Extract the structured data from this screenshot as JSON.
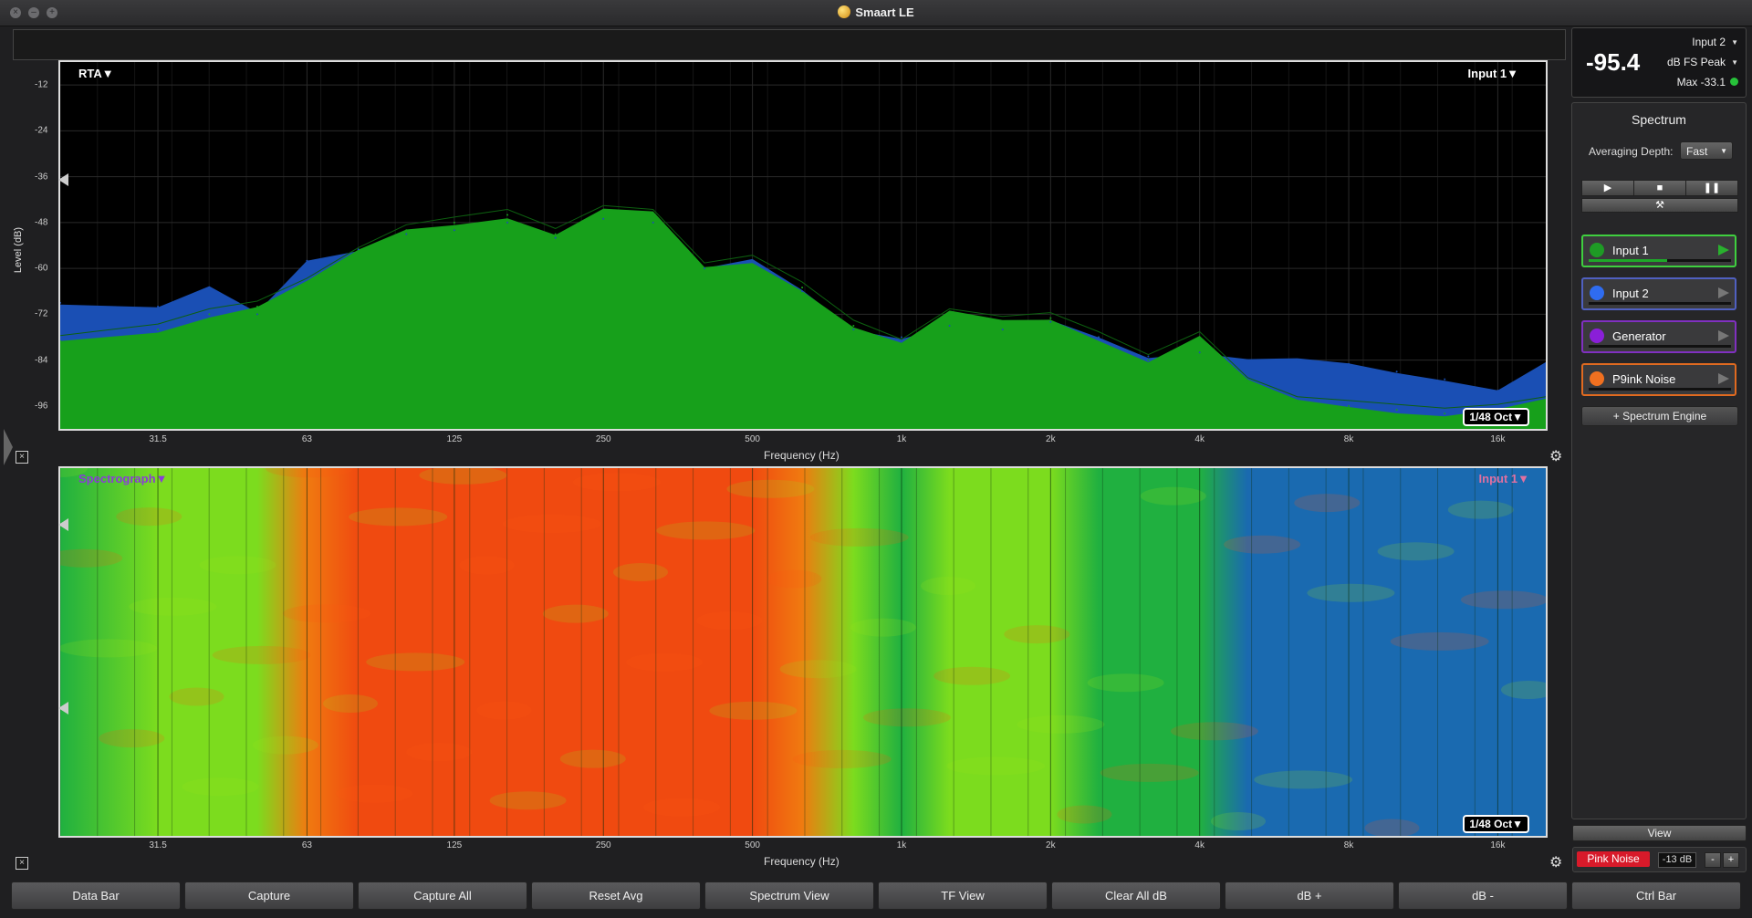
{
  "window": {
    "title": "Smaart LE"
  },
  "meter": {
    "value": "-95.4",
    "input": "Input 2",
    "mode": "dB FS Peak",
    "max": "Max -33.1"
  },
  "rta": {
    "mode_label": "RTA▼",
    "input_label": "Input 1▼",
    "resolution": "1/48 Oct▼",
    "ylabel": "Level (dB)",
    "xlabel": "Frequency (Hz)",
    "yticks": [
      "-12",
      "-24",
      "-36",
      "-48",
      "-60",
      "-72",
      "-84",
      "-96"
    ],
    "xticks": [
      "31.5",
      "63",
      "125",
      "250",
      "500",
      "1k",
      "2k",
      "4k",
      "8k",
      "16k"
    ]
  },
  "spectrograph": {
    "mode_label": "Spectrograph▼",
    "input_label": "Input 1▼",
    "resolution": "1/48 Oct▼",
    "xlabel": "Frequency (Hz)",
    "xticks": [
      "31.5",
      "63",
      "125",
      "250",
      "500",
      "1k",
      "2k",
      "4k",
      "8k",
      "16k"
    ]
  },
  "chart_data": {
    "type": "area",
    "title": "RTA",
    "xlabel": "Frequency (Hz)",
    "ylabel": "Level (dB)",
    "x_scale": "log",
    "xlim": [
      20,
      20000
    ],
    "ylim": [
      -102,
      -6
    ],
    "grid": true,
    "x": [
      20,
      31.5,
      40,
      50,
      63,
      80,
      100,
      125,
      160,
      200,
      250,
      315,
      400,
      500,
      630,
      800,
      1000,
      1250,
      1600,
      2000,
      2500,
      3150,
      4000,
      5000,
      6300,
      8000,
      10000,
      12500,
      16000,
      20000
    ],
    "series": [
      {
        "name": "Input 1",
        "color": "#17a01b",
        "values": [
          -79,
          -76,
          -72,
          -70,
          -64,
          -56,
          -50,
          -48,
          -46,
          -51,
          -45,
          -46,
          -60,
          -58,
          -65,
          -75,
          -80,
          -72,
          -74,
          -73,
          -78,
          -84,
          -78,
          -90,
          -95,
          -96,
          -97,
          -98,
          -97,
          -95
        ]
      },
      {
        "name": "Input 2",
        "color": "#1a4fb4",
        "values": [
          -69,
          -70,
          -65,
          -72,
          -58,
          -55,
          -51,
          -50,
          -48,
          -52,
          -47,
          -48,
          -60,
          -58,
          -66,
          -76,
          -78,
          -75,
          -76,
          -74,
          -78,
          -83,
          -82,
          -84,
          -84,
          -85,
          -87,
          -89,
          -92,
          -85
        ]
      }
    ]
  },
  "spectrum_panel": {
    "title": "Spectrum",
    "averaging_label": "Averaging Depth:",
    "averaging_value": "Fast",
    "channels": [
      {
        "label": "Input 1",
        "color": "#1e9b25",
        "border": "#3fcf3f",
        "level": 0.55
      },
      {
        "label": "Input 2",
        "color": "#2f6cf0",
        "border": "#5060c0",
        "level": 0.0
      },
      {
        "label": "Generator",
        "color": "#8a1fd8",
        "border": "#8030c0",
        "level": 0.0
      },
      {
        "label": "P9ink Noise",
        "color": "#f07020",
        "border": "#e06a20",
        "level": 0.0
      }
    ],
    "engine_button": "+ Spectrum Engine",
    "view_button": "View"
  },
  "generator": {
    "button": "Pink Noise",
    "level": "-13 dB",
    "minus": "-",
    "plus": "+"
  },
  "bottombar": [
    "Data Bar",
    "Capture",
    "Capture All",
    "Reset Avg",
    "Spectrum View",
    "TF View",
    "Clear All dB",
    "dB +",
    "dB -",
    "Ctrl Bar"
  ]
}
